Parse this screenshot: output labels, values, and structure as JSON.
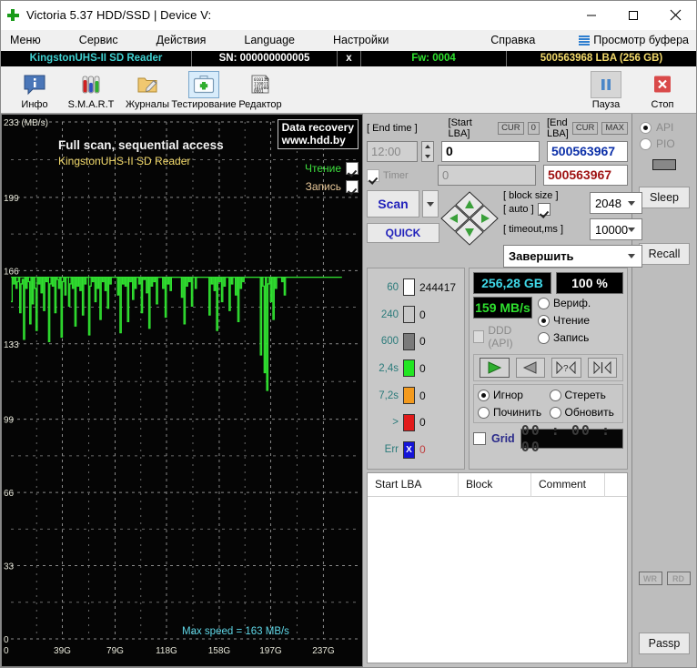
{
  "window": {
    "title": "Victoria 5.37 HDD/SSD | Device V:",
    "app_icon": "green-plus-icon",
    "minimize": "─",
    "maximize": "□",
    "close": "✕"
  },
  "menu": {
    "items": [
      {
        "label": "Меню"
      },
      {
        "label": "Сервис"
      },
      {
        "label": "Действия"
      },
      {
        "label": "Language"
      },
      {
        "label": "Настройки"
      },
      {
        "label": "Справка"
      }
    ],
    "buffer_label": "Просмотр буфера"
  },
  "device": {
    "model": "KingstonUHS-II SD Reader",
    "serial": "SN: 000000000005",
    "x_button": "x",
    "firmware": "Fw: 0004",
    "capacity": "500563968 LBA (256 GB)",
    "model_color": "#3fd0d0",
    "fw_color": "#2ee02e",
    "lba_color": "#f2d96a"
  },
  "toolbar": {
    "buttons": [
      {
        "label": "Инфо",
        "icon": "info-icon",
        "selected": false
      },
      {
        "label": "S.M.A.R.T",
        "icon": "test-tubes-icon",
        "selected": false
      },
      {
        "label": "Журналы",
        "icon": "folder-pencil-icon",
        "selected": false
      },
      {
        "label": "Тестирование",
        "icon": "first-aid-kit-icon",
        "selected": true
      },
      {
        "label": "Редактор",
        "icon": "binary-document-icon",
        "selected": false
      }
    ],
    "pause": {
      "label": "Пауза",
      "icon": "pause-icon"
    },
    "stop": {
      "label": "Стоп",
      "icon": "stop-x-icon"
    }
  },
  "chart_data": {
    "type": "line",
    "title": "Full scan, sequential access",
    "subtitle": "KingstonUHS-II SD Reader",
    "ylabel": "233 (MB/s)",
    "xlabel": "",
    "ylim": [
      0,
      233
    ],
    "xlim": [
      0,
      265
    ],
    "grid": true,
    "yticks": [
      "233 (MB/s)",
      "199",
      "166",
      "133",
      "99",
      "66",
      "33",
      "0"
    ],
    "ytick_values": [
      233,
      199,
      166,
      133,
      99,
      66,
      33,
      0
    ],
    "xticks": [
      "0",
      "39G",
      "79G",
      "118G",
      "158G",
      "197G",
      "237G"
    ],
    "xtick_values": [
      0,
      39,
      79,
      118,
      158,
      197,
      237
    ],
    "annotation": "Max speed = 163 MB/s",
    "max_speed": 163,
    "series_name": "read-speed",
    "series_color": "#30e030",
    "background": "#050505",
    "values": [
      152,
      163,
      160,
      163,
      158,
      161,
      163,
      147,
      160,
      162,
      135,
      163,
      158,
      163,
      161,
      142,
      163,
      151,
      163,
      158,
      139,
      163,
      160,
      163,
      156,
      163,
      148,
      163,
      161,
      163,
      134,
      160,
      163,
      159,
      163,
      147,
      163,
      162,
      158,
      163,
      136,
      161,
      163,
      155,
      163,
      163,
      150,
      160,
      163,
      158,
      163,
      141,
      163,
      159,
      163,
      157,
      163,
      146,
      163,
      160,
      163,
      163,
      137,
      159,
      163,
      161,
      163,
      152,
      163,
      158,
      163,
      144,
      163,
      161,
      163,
      157,
      163,
      149,
      163,
      160,
      163,
      163,
      163,
      163,
      163,
      155,
      163,
      138,
      163,
      160,
      163,
      159,
      163,
      143,
      163,
      161,
      163,
      153,
      163,
      158,
      163,
      163,
      160,
      163,
      147,
      163,
      162,
      163,
      156,
      163,
      140,
      163,
      159,
      163,
      161,
      163,
      151,
      163,
      163,
      163,
      163,
      158,
      163,
      145,
      163,
      160,
      163,
      157,
      163,
      163,
      163,
      163,
      163,
      163,
      163,
      163,
      154,
      163,
      142,
      163,
      159,
      163,
      161,
      163,
      150,
      163,
      163,
      158,
      163,
      163,
      163,
      163,
      163,
      163,
      163,
      163,
      163,
      163,
      146,
      163,
      160,
      163,
      157,
      163,
      139,
      163,
      161,
      163,
      152,
      163,
      159,
      163,
      163,
      163,
      148,
      163,
      160,
      163,
      163,
      155,
      163,
      143,
      163,
      158,
      163,
      161,
      163,
      163,
      163,
      163,
      163,
      163,
      163,
      163,
      163,
      163,
      163,
      163,
      163,
      128,
      163,
      159,
      120,
      163,
      112,
      160,
      163,
      152,
      163,
      144,
      163,
      158,
      163,
      163,
      163,
      163,
      161,
      163,
      155,
      163,
      163,
      163,
      163,
      163,
      163,
      163,
      163,
      163,
      163,
      163,
      163,
      163,
      163,
      163,
      163,
      163,
      163,
      163,
      163,
      163,
      163,
      163,
      163,
      163,
      163,
      163,
      163,
      163,
      163,
      163,
      163,
      163,
      163,
      163,
      163,
      163,
      163,
      163,
      163,
      163,
      163,
      163,
      163,
      163,
      163
    ],
    "legend": [
      {
        "label": "Чтение",
        "color": "#3ee03e",
        "checked": true
      },
      {
        "label": "Запись",
        "color": "#e8c899",
        "checked": true
      }
    ],
    "watermark_line1": "Data recovery",
    "watermark_line2": "www.hdd.by"
  },
  "params": {
    "end_time_label": "[ End time ]",
    "end_time_value": "12:00",
    "timer_label": "Timer",
    "timer_checked": true,
    "start_lba_label": "[Start LBA]",
    "start_lba_cur": "CUR",
    "start_lba_zero": "0",
    "start_lba_value": "0",
    "start_lba_value2": "0",
    "end_lba_label": "[End LBA]",
    "end_lba_cur": "CUR",
    "end_lba_max": "MAX",
    "end_lba_value": "500563967",
    "end_lba_value2": "500563967",
    "scan_label": "Scan",
    "quick_label": "QUICK",
    "dpad": "direction-pad",
    "block_size_label": "[ block size ]",
    "block_size_value": "2048",
    "auto_label": "[ auto ]",
    "auto_checked": true,
    "timeout_label": "[ timeout,ms ]",
    "timeout_value": "10000",
    "finish_action": "Завершить"
  },
  "block_legend": {
    "rows": [
      {
        "time": "60",
        "color": "#ffffff",
        "value": "244417"
      },
      {
        "time": "240",
        "color": "#c8c8c8",
        "value": "0"
      },
      {
        "time": "600",
        "color": "#7a7a7a",
        "value": "0"
      },
      {
        "time": "2,4s",
        "color": "#22e622",
        "value": "0"
      },
      {
        "time": "7,2s",
        "color": "#f39a1e",
        "value": "0"
      },
      {
        "time": ">",
        "color": "#e11b1b",
        "value": "0"
      },
      {
        "time": "Err",
        "color": "#1515d8",
        "value": "0",
        "glyph": "X",
        "err": true
      }
    ]
  },
  "stats": {
    "capacity_led": "256,28 GB",
    "percent_led": "100    %",
    "speed_led": "159 MB/s",
    "ddd_label": "DDD (API)",
    "ddd_checked": false,
    "modes": [
      {
        "label": "Вериф.",
        "checked": false
      },
      {
        "label": "Чтение",
        "checked": true
      },
      {
        "label": "Запись",
        "checked": false
      }
    ],
    "play_buttons": [
      {
        "name": "play-forward-button",
        "icon": "play-right-green-icon"
      },
      {
        "name": "play-reverse-button",
        "icon": "play-left-gray-icon"
      },
      {
        "name": "random-seek-button",
        "icon": "question-seek-icon"
      },
      {
        "name": "seek-end-button",
        "icon": "seek-end-icon"
      }
    ],
    "actions": [
      {
        "label": "Игнор",
        "checked": true
      },
      {
        "label": "Стереть",
        "checked": false
      },
      {
        "label": "Починить",
        "checked": false
      },
      {
        "label": "Обновить",
        "checked": false
      }
    ],
    "grid_label": "Grid",
    "grid_checked": false,
    "elapsed_time": "00 : 00 : 00"
  },
  "table": {
    "columns": [
      "Start LBA",
      "Block",
      "Comment"
    ],
    "rows": []
  },
  "sidebar": {
    "api_label": "API",
    "api_checked": true,
    "pio_label": "PIO",
    "pio_checked": false,
    "sleep_label": "Sleep",
    "recall_label": "Recall",
    "wr_label": "WR",
    "rd_label": "RD",
    "passp_label": "Passp"
  }
}
